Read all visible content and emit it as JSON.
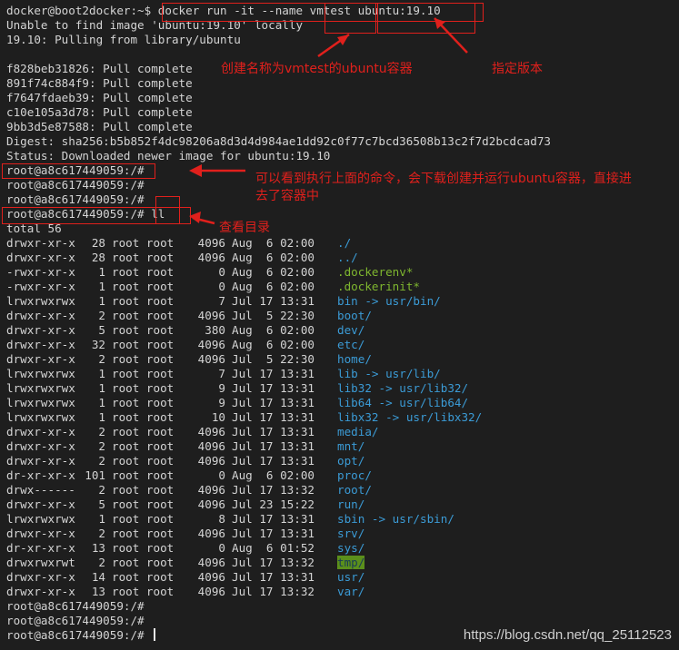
{
  "terminal": {
    "header_lines": [
      "docker@boot2docker:~$ docker run -it --name vmtest ubuntu:19.10",
      "Unable to find image 'ubuntu:19.10' locally",
      "19.10: Pulling from library/ubuntu",
      "",
      "f828beb31826: Pull complete",
      "891f74c884f9: Pull complete",
      "f7647fdaeb39: Pull complete",
      "c10e105a3d78: Pull complete",
      "9bb3d5e87588: Pull complete",
      "Digest: sha256:b5b852f4dc98206a8d3d4d984ae1dd92c0f77c7bcd36508b13c2f7d2bcdcad73",
      "Status: Downloaded newer image for ubuntu:19.10",
      "root@a8c617449059:/#",
      "root@a8c617449059:/#",
      "root@a8c617449059:/#",
      "root@a8c617449059:/# ll",
      "total 56"
    ],
    "listing": [
      {
        "perm": "drwxr-xr-x",
        "links": "28",
        "owner": "root root",
        "size": "4096",
        "date": "Aug  6 02:00",
        "name": "./",
        "color": "blue",
        "name_only": "./"
      },
      {
        "perm": "drwxr-xr-x",
        "links": "28",
        "owner": "root root",
        "size": "4096",
        "date": "Aug  6 02:00",
        "name": "../",
        "color": "blue"
      },
      {
        "perm": "-rwxr-xr-x",
        "links": "1",
        "owner": "root root",
        "size": "0",
        "date": "Aug  6 02:00",
        "name": ".dockerenv*",
        "color": "green"
      },
      {
        "perm": "-rwxr-xr-x",
        "links": "1",
        "owner": "root root",
        "size": "0",
        "date": "Aug  6 02:00",
        "name": ".dockerinit*",
        "color": "green"
      },
      {
        "perm": "lrwxrwxrwx",
        "links": "1",
        "owner": "root root",
        "size": "7",
        "date": "Jul 17 13:31",
        "name": "bin -> usr/bin/",
        "color": "blue"
      },
      {
        "perm": "drwxr-xr-x",
        "links": "2",
        "owner": "root root",
        "size": "4096",
        "date": "Jul  5 22:30",
        "name": "boot/",
        "color": "blue"
      },
      {
        "perm": "drwxr-xr-x",
        "links": "5",
        "owner": "root root",
        "size": "380",
        "date": "Aug  6 02:00",
        "name": "dev/",
        "color": "blue"
      },
      {
        "perm": "drwxr-xr-x",
        "links": "32",
        "owner": "root root",
        "size": "4096",
        "date": "Aug  6 02:00",
        "name": "etc/",
        "color": "blue"
      },
      {
        "perm": "drwxr-xr-x",
        "links": "2",
        "owner": "root root",
        "size": "4096",
        "date": "Jul  5 22:30",
        "name": "home/",
        "color": "blue"
      },
      {
        "perm": "lrwxrwxrwx",
        "links": "1",
        "owner": "root root",
        "size": "7",
        "date": "Jul 17 13:31",
        "name": "lib -> usr/lib/",
        "color": "blue"
      },
      {
        "perm": "lrwxrwxrwx",
        "links": "1",
        "owner": "root root",
        "size": "9",
        "date": "Jul 17 13:31",
        "name": "lib32 -> usr/lib32/",
        "color": "blue"
      },
      {
        "perm": "lrwxrwxrwx",
        "links": "1",
        "owner": "root root",
        "size": "9",
        "date": "Jul 17 13:31",
        "name": "lib64 -> usr/lib64/",
        "color": "blue"
      },
      {
        "perm": "lrwxrwxrwx",
        "links": "1",
        "owner": "root root",
        "size": "10",
        "date": "Jul 17 13:31",
        "name": "libx32 -> usr/libx32/",
        "color": "blue"
      },
      {
        "perm": "drwxr-xr-x",
        "links": "2",
        "owner": "root root",
        "size": "4096",
        "date": "Jul 17 13:31",
        "name": "media/",
        "color": "blue"
      },
      {
        "perm": "drwxr-xr-x",
        "links": "2",
        "owner": "root root",
        "size": "4096",
        "date": "Jul 17 13:31",
        "name": "mnt/",
        "color": "blue"
      },
      {
        "perm": "drwxr-xr-x",
        "links": "2",
        "owner": "root root",
        "size": "4096",
        "date": "Jul 17 13:31",
        "name": "opt/",
        "color": "blue"
      },
      {
        "perm": "dr-xr-xr-x",
        "links": "101",
        "owner": "root root",
        "size": "0",
        "date": "Aug  6 02:00",
        "name": "proc/",
        "color": "blue"
      },
      {
        "perm": "drwx------",
        "links": "2",
        "owner": "root root",
        "size": "4096",
        "date": "Jul 17 13:32",
        "name": "root/",
        "color": "blue"
      },
      {
        "perm": "drwxr-xr-x",
        "links": "5",
        "owner": "root root",
        "size": "4096",
        "date": "Jul 23 15:22",
        "name": "run/",
        "color": "blue"
      },
      {
        "perm": "lrwxrwxrwx",
        "links": "1",
        "owner": "root root",
        "size": "8",
        "date": "Jul 17 13:31",
        "name": "sbin -> usr/sbin/",
        "color": "blue"
      },
      {
        "perm": "drwxr-xr-x",
        "links": "2",
        "owner": "root root",
        "size": "4096",
        "date": "Jul 17 13:31",
        "name": "srv/",
        "color": "blue"
      },
      {
        "perm": "dr-xr-xr-x",
        "links": "13",
        "owner": "root root",
        "size": "0",
        "date": "Aug  6 01:52",
        "name": "sys/",
        "color": "blue"
      },
      {
        "perm": "drwxrwxrwt",
        "links": "2",
        "owner": "root root",
        "size": "4096",
        "date": "Jul 17 13:32",
        "name": "tmp/",
        "color": "tmp"
      },
      {
        "perm": "drwxr-xr-x",
        "links": "14",
        "owner": "root root",
        "size": "4096",
        "date": "Jul 17 13:31",
        "name": "usr/",
        "color": "blue"
      },
      {
        "perm": "drwxr-xr-x",
        "links": "13",
        "owner": "root root",
        "size": "4096",
        "date": "Jul 17 13:32",
        "name": "var/",
        "color": "blue"
      }
    ],
    "footer_lines": [
      "root@a8c617449059:/#",
      "root@a8c617449059:/#",
      "root@a8c617449059:/# "
    ]
  },
  "annotations": {
    "name_note": "创建名称为vmtest的ubuntu容器",
    "version_note": "指定版本",
    "run_note_line1": "可以看到执行上面的命令，会下载创建并运行ubuntu容器，直接进",
    "run_note_line2": "去了容器中",
    "ll_note": "查看目录"
  },
  "watermark": "https://blog.csdn.net/qq_25112523",
  "colors": {
    "background": "#1e1e1e",
    "text": "#d4d4d4",
    "directory": "#3b9bd6",
    "executable": "#7fb72f",
    "annotation": "#e0201c"
  }
}
